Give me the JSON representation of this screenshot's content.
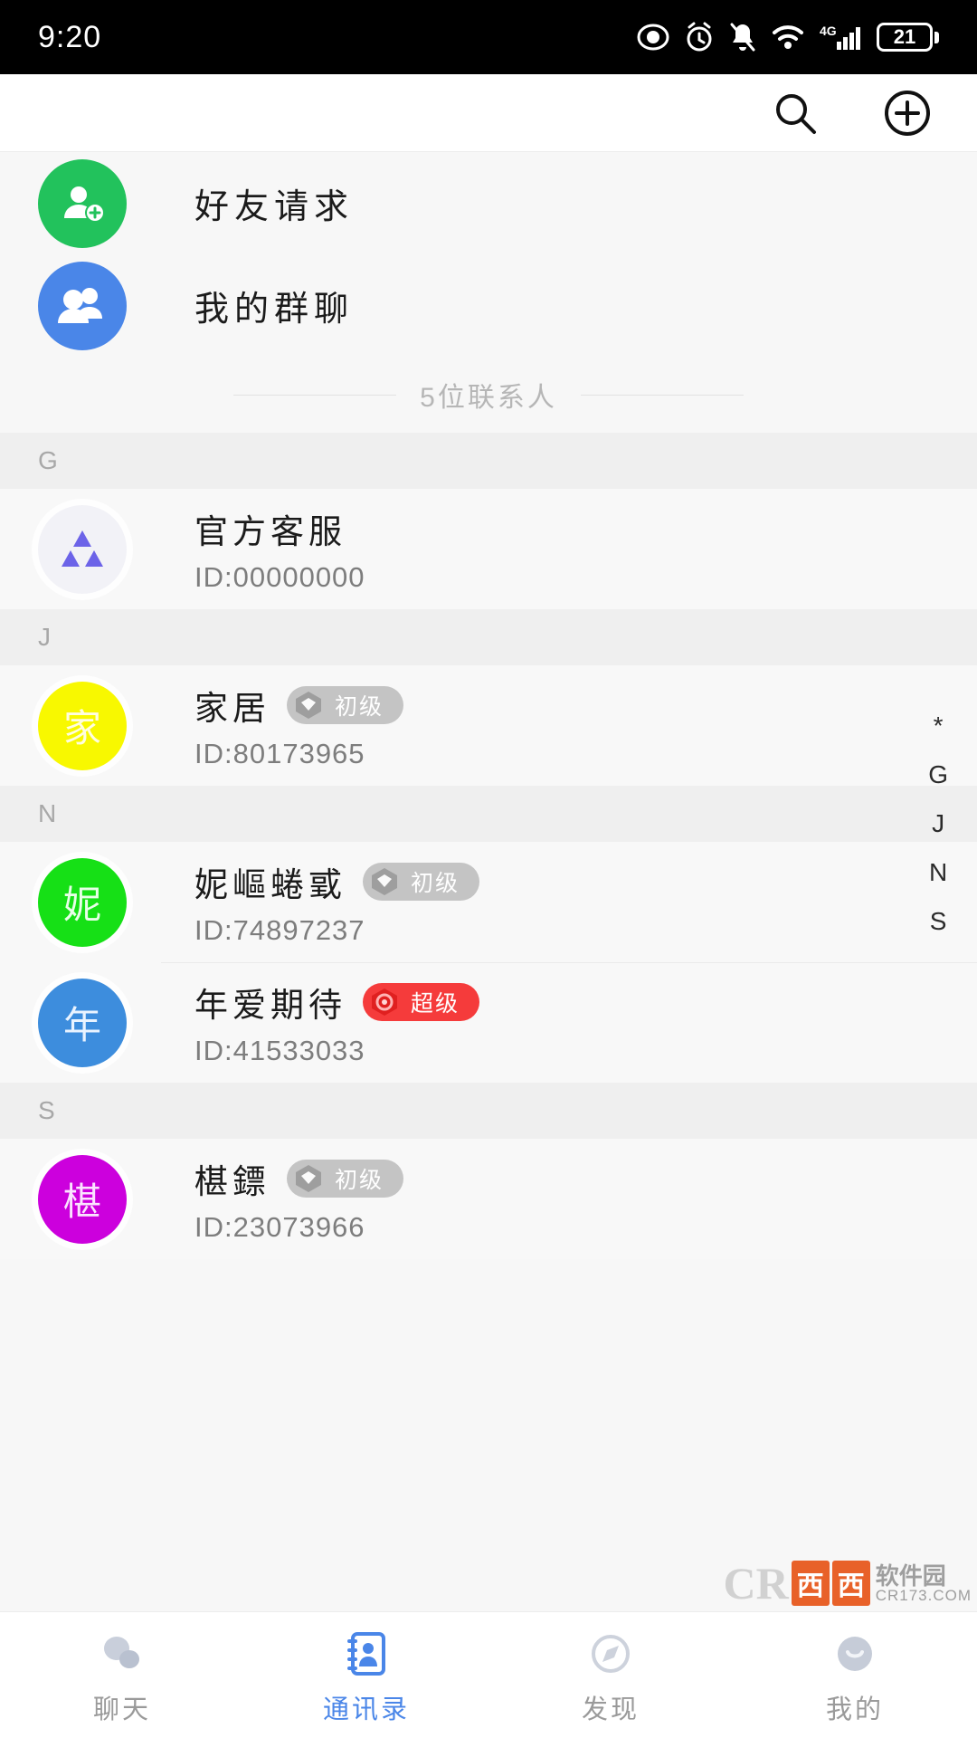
{
  "statusbar": {
    "time": "9:20",
    "battery_level": "21",
    "network": "4G",
    "icons": [
      "eye-icon",
      "alarm-icon",
      "mute-bell-icon",
      "wifi-icon",
      "signal-icon",
      "battery-icon"
    ]
  },
  "appbar": {
    "search_icon": "search-icon",
    "add_icon": "plus-circle-icon"
  },
  "entries": [
    {
      "label": "好友请求",
      "icon": "person-add-icon",
      "color": "#22c25c"
    },
    {
      "label": "我的群聊",
      "icon": "group-icon",
      "color": "#4a86e8"
    }
  ],
  "contacts_count": "5位联系人",
  "sections": [
    {
      "letter": "G",
      "contacts": [
        {
          "name": "官方客服",
          "id": "ID:00000000",
          "avatar_type": "logo",
          "avatar_text": "",
          "avatar_color": "#f2f2f7",
          "badge": null
        }
      ]
    },
    {
      "letter": "J",
      "contacts": [
        {
          "name": "家居",
          "id": "ID:80173965",
          "avatar_type": "text",
          "avatar_text": "家",
          "avatar_color": "#f8f800",
          "badge": {
            "label": "初级",
            "style": "gray",
            "color": "#c4c4c4"
          }
        }
      ]
    },
    {
      "letter": "N",
      "contacts": [
        {
          "name": "妮嶇蜷戜",
          "id": "ID:74897237",
          "avatar_type": "text",
          "avatar_text": "妮",
          "avatar_color": "#16e016",
          "badge": {
            "label": "初级",
            "style": "gray",
            "color": "#c4c4c4"
          }
        },
        {
          "name": "年爱期待",
          "id": "ID:41533033",
          "avatar_type": "text",
          "avatar_text": "年",
          "avatar_color": "#3d8ddd",
          "badge": {
            "label": "超级",
            "style": "red",
            "color": "#f53b3b"
          }
        }
      ]
    },
    {
      "letter": "S",
      "contacts": [
        {
          "name": "椹鏢",
          "id": "ID:23073966",
          "avatar_type": "text",
          "avatar_text": "椹",
          "avatar_color": "#cc00dd",
          "badge": {
            "label": "初级",
            "style": "gray",
            "color": "#c4c4c4"
          }
        }
      ]
    }
  ],
  "index_bar": [
    "*",
    "G",
    "J",
    "N",
    "S"
  ],
  "tabbar": [
    {
      "label": "聊天",
      "icon": "chat-bubbles-icon",
      "active": false
    },
    {
      "label": "通讯录",
      "icon": "contacts-book-icon",
      "active": true
    },
    {
      "label": "发现",
      "icon": "compass-icon",
      "active": false
    },
    {
      "label": "我的",
      "icon": "profile-icon",
      "active": false
    }
  ],
  "watermark": {
    "mark": "CR",
    "box1": "西",
    "box2": "西",
    "name": "软件园",
    "url": "CR173.COM"
  },
  "theme": {
    "accent": "#4a86e8",
    "page_bg": "#f7f7f7",
    "row_bg": "#f8f8f8",
    "section_bg": "#efefef"
  }
}
